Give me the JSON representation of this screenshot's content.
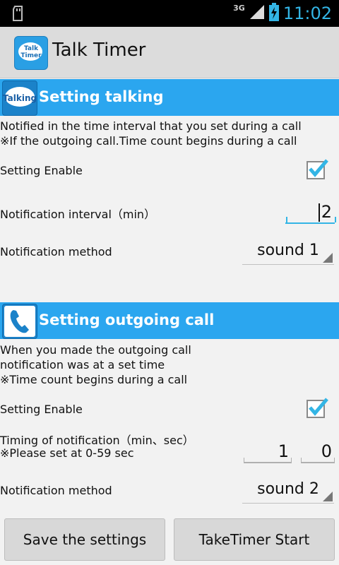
{
  "status_bar": {
    "network": "3G",
    "time": "11:02"
  },
  "action_bar": {
    "app_icon_text_1": "Talk",
    "app_icon_text_2": "Timer",
    "title": "Talk Timer"
  },
  "talking": {
    "icon_label": "Talking",
    "header": "Setting talking",
    "desc_1": "Notified in the time interval that you set during a call",
    "desc_2": "※If the outgoing call.Time count begins during a call",
    "enable_label": "Setting Enable",
    "enable_checked": true,
    "interval_label": "Notification interval（min）",
    "interval_value": "2",
    "method_label": "Notification method",
    "method_value": "sound 1"
  },
  "outgoing": {
    "header": "Setting outgoing call",
    "desc_1": "When you made the outgoing call",
    "desc_2": "notification was at a set time",
    "desc_3": "※Time count begins during a call",
    "enable_label": "Setting Enable",
    "enable_checked": true,
    "timing_label": "Timing of notification（min、sec）",
    "timing_note": "※Please set at 0-59 sec",
    "min_value": "1",
    "sec_value": "0",
    "method_label": "Notification method",
    "method_value": "sound 2"
  },
  "buttons": {
    "save": "Save the settings",
    "start": "TakeTimer Start"
  },
  "colors": {
    "accent": "#2ba6ef",
    "status_time": "#33b5e5",
    "checkmark": "#33b5e5"
  }
}
